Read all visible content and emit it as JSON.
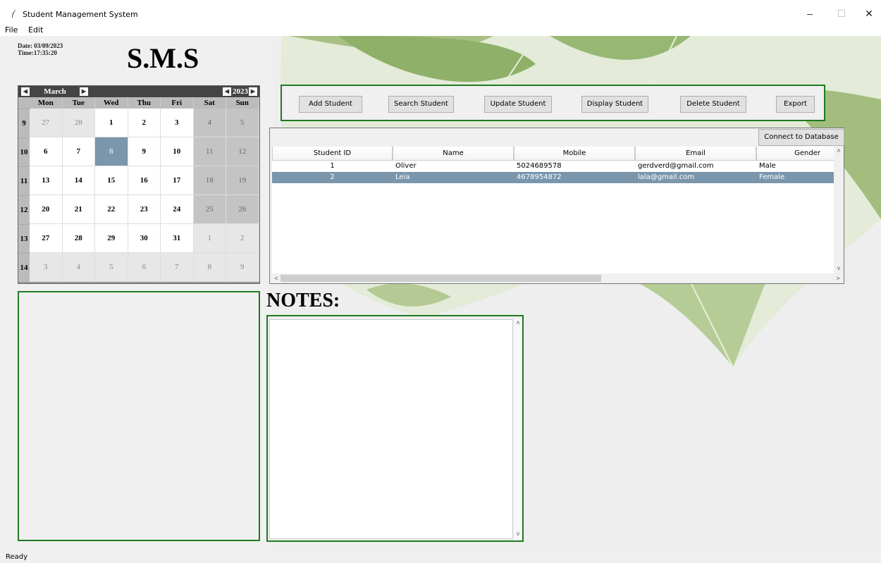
{
  "window": {
    "title": "Student Management System",
    "controls": {
      "minimize": "–",
      "maximize": "☐",
      "close": "✕"
    }
  },
  "menu": {
    "file": "File",
    "edit": "Edit"
  },
  "header": {
    "date_label": "Date: 03/09/2023",
    "time_label": "Time:17:35:20",
    "app_title": "S.M.S"
  },
  "calendar": {
    "month": "March",
    "year": "2023",
    "weekdays": [
      "Mon",
      "Tue",
      "Wed",
      "Thu",
      "Fri",
      "Sat",
      "Sun"
    ],
    "weeks": [
      {
        "num": "9",
        "days": [
          "27",
          "28",
          "1",
          "2",
          "3",
          "4",
          "5"
        ]
      },
      {
        "num": "10",
        "days": [
          "6",
          "7",
          "8",
          "9",
          "10",
          "11",
          "12"
        ]
      },
      {
        "num": "11",
        "days": [
          "13",
          "14",
          "15",
          "16",
          "17",
          "18",
          "19"
        ]
      },
      {
        "num": "12",
        "days": [
          "20",
          "21",
          "22",
          "23",
          "24",
          "25",
          "26"
        ]
      },
      {
        "num": "13",
        "days": [
          "27",
          "28",
          "29",
          "30",
          "31",
          "1",
          "2"
        ]
      },
      {
        "num": "14",
        "days": [
          "3",
          "4",
          "5",
          "6",
          "7",
          "8",
          "9"
        ]
      }
    ],
    "selected_day": "8"
  },
  "toolbar": {
    "add": "Add Student",
    "search": "Search Student",
    "update": "Update Student",
    "display": "Display Student",
    "delete": "Delete Student",
    "export": "Export"
  },
  "table": {
    "connect_button": "Connect to Database",
    "columns": [
      "Student ID",
      "Name",
      "Mobile",
      "Email",
      "Gender"
    ],
    "rows": [
      {
        "id": "1",
        "name": "Oliver",
        "mobile": "5024689578",
        "email": "gerdverd@gmail.com",
        "gender": "Male"
      },
      {
        "id": "2",
        "name": "Leia",
        "mobile": "4678954872",
        "email": "lala@gmail.com",
        "gender": "Female"
      }
    ],
    "selected_row": 1
  },
  "notes": {
    "label": "NOTES:",
    "text": ""
  },
  "status": {
    "text": "Ready"
  },
  "colors": {
    "frame_border": "#1f7a1f",
    "selection": "#7a96ac",
    "background": "#f0f0f0"
  }
}
